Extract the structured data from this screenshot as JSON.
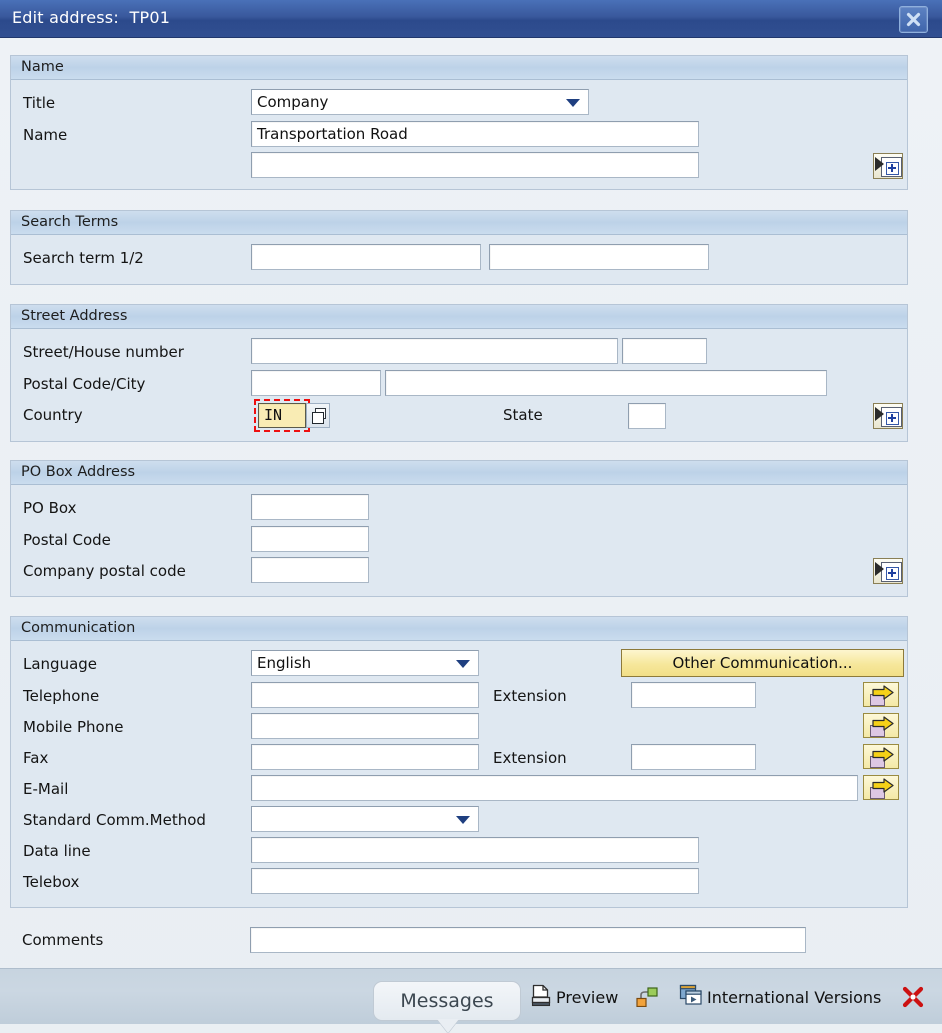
{
  "window": {
    "title": "Edit address:  TP01",
    "close_icon": "close-icon"
  },
  "sections": {
    "name": {
      "header": "Name",
      "title_label": "Title",
      "title_value": "Company",
      "name_label": "Name",
      "name_value": "Transportation Road",
      "name2_value": "",
      "detail_icon": "details-expand-icon"
    },
    "search_terms": {
      "header": "Search Terms",
      "search_term_label": "Search term 1/2",
      "search_term_1": "",
      "search_term_2": ""
    },
    "street_address": {
      "header": "Street Address",
      "street_label": "Street/House number",
      "street_value": "",
      "house_number_value": "",
      "postal_city_label": "Postal Code/City",
      "postal_code_value": "",
      "city_value": "",
      "country_label": "Country",
      "country_value": "IN",
      "country_help_icon": "search-help-icon",
      "state_label": "State",
      "state_value": "",
      "detail_icon": "details-expand-icon"
    },
    "po_box": {
      "header": "PO Box Address",
      "po_box_label": "PO Box",
      "po_box_value": "",
      "postal_code_label": "Postal Code",
      "postal_code_value": "",
      "company_postal_label": "Company postal code",
      "company_postal_value": "",
      "detail_icon": "details-expand-icon"
    },
    "communication": {
      "header": "Communication",
      "language_label": "Language",
      "language_value": "English",
      "other_communication_label": "Other Communication...",
      "telephone_label": "Telephone",
      "telephone_value": "",
      "telephone_ext_label": "Extension",
      "telephone_ext_value": "",
      "mobile_label": "Mobile Phone",
      "mobile_value": "",
      "fax_label": "Fax",
      "fax_value": "",
      "fax_ext_label": "Extension",
      "fax_ext_value": "",
      "email_label": "E-Mail",
      "email_value": "",
      "std_comm_label": "Standard Comm.Method",
      "std_comm_value": "",
      "data_line_label": "Data line",
      "data_line_value": "",
      "telebox_label": "Telebox",
      "telebox_value": "",
      "goto_icon": "goto-arrow-icon"
    }
  },
  "comments": {
    "label": "Comments",
    "value": ""
  },
  "footer": {
    "messages_label": "Messages",
    "preview_label": "Preview",
    "preview_icon": "print-preview-icon",
    "relationship_icon": "relationship-icon",
    "international_versions_label": "International Versions",
    "international_versions_icon": "international-versions-icon",
    "cancel_icon": "cancel-red-x-icon"
  },
  "colors": {
    "titlebar": "#39589c",
    "panel_bg": "#dfe8f1",
    "panel_header": "#c4d6e9",
    "focus_border": "#ee0f0f",
    "focus_field_bg": "#f9ecb4",
    "yellow_button": "#f6e79b",
    "cancel_red": "#cc1111",
    "page_bg": "#eaeff3"
  }
}
